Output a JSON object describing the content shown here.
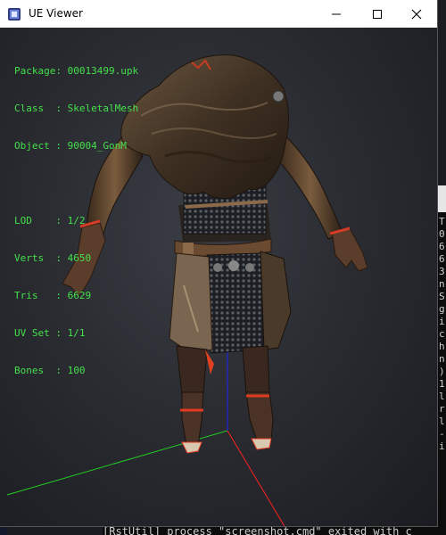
{
  "window": {
    "title": "UE Viewer"
  },
  "info": {
    "package_label": "Package:",
    "package": "00013499.upk",
    "class_label": "Class  :",
    "class": "SkeletalMesh",
    "object_label": "Object :",
    "object": "90004_GonM",
    "lod_label": "LOD    :",
    "lod": "1/2",
    "verts_label": "Verts  :",
    "verts": "4650",
    "tris_label": "Tris   :",
    "tris": "6629",
    "uvset_label": "UV Set :",
    "uvset": "1/1",
    "bones_label": "Bones  :",
    "bones": "100"
  },
  "background": {
    "left_glyph": "M",
    "console_chars": "T 0 6 6 3 n S g i c h n ) 1 l r l - i",
    "bottom_log": "[RstUtil] process \"screenshot.cmd\" exited with c"
  },
  "colors": {
    "info_text": "#44e04a",
    "axis_x": "#ff2020",
    "axis_y": "#22cc22",
    "axis_z": "#2020ff"
  },
  "icons": {
    "minimize": "minimize-icon",
    "maximize": "maximize-icon",
    "close": "close-icon"
  }
}
